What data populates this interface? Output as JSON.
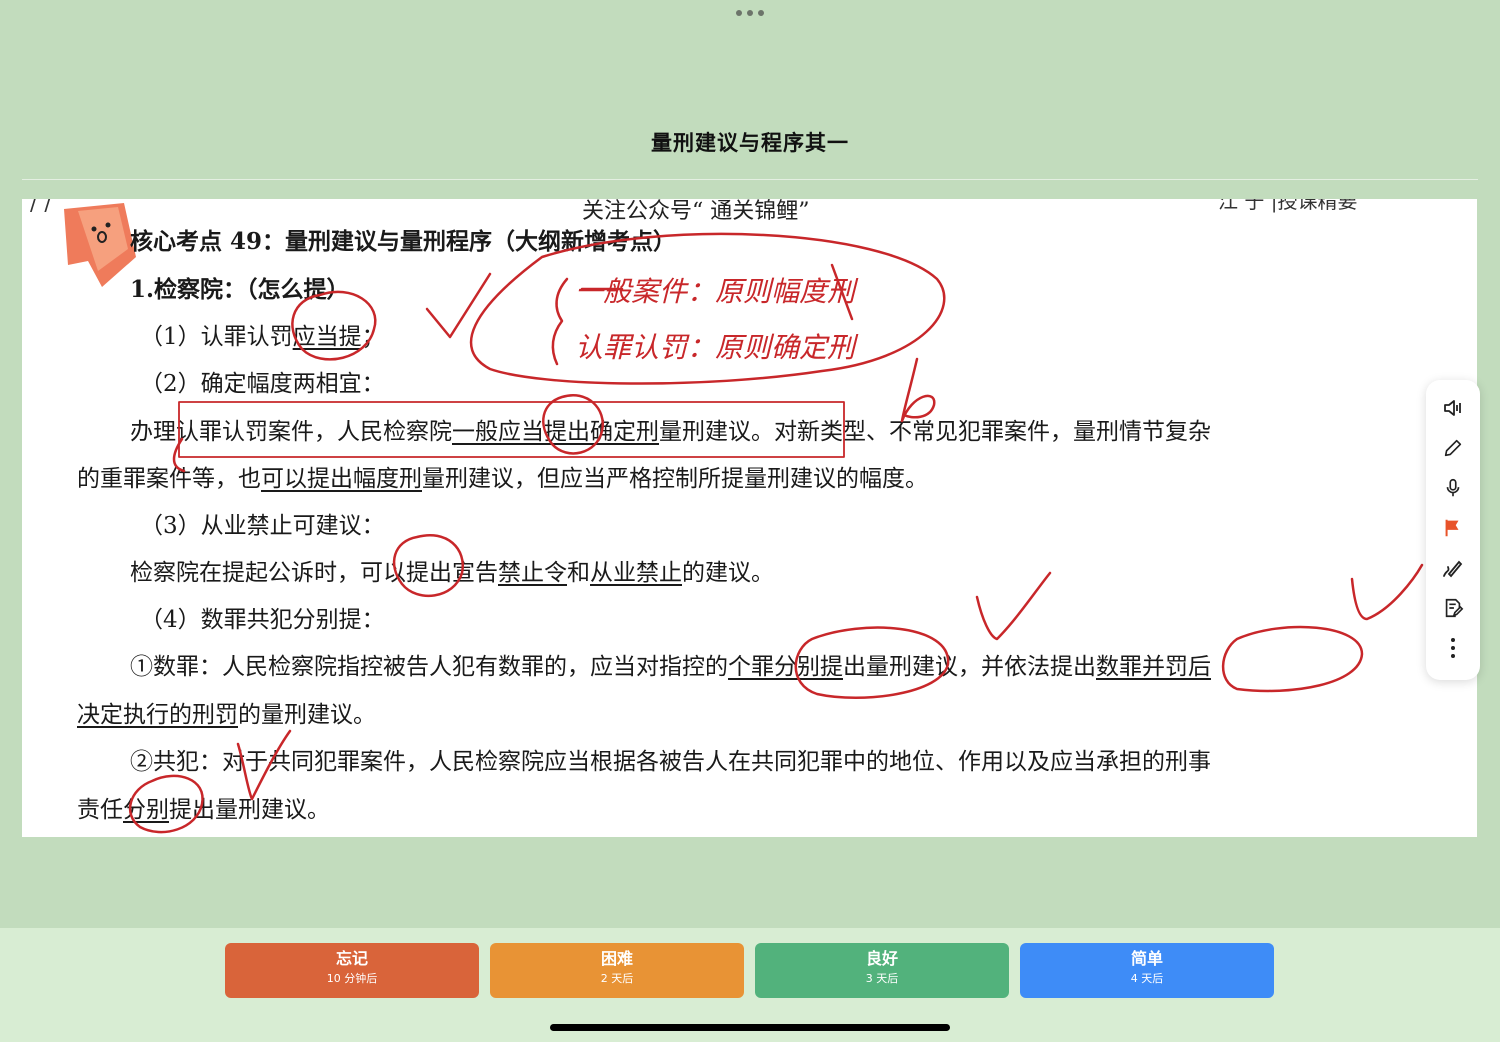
{
  "card": {
    "title": "量刑建议与程序其一"
  },
  "doc": {
    "left_mark": "/ /",
    "header": "关注公众号“ 通关锦鲤”",
    "header_right": "江 于 |授课精要",
    "heading": "核心考点 49：量刑建议与量刑程序（大纲新增考点）",
    "section1": "1.检察院：（怎么提）",
    "item1_pre": "（1）认罪认罚",
    "item1_u": "应当提",
    "item1_post": "；",
    "item2": "（2）确定幅度两相宜：",
    "p2a_1": "办理认罪认罚案件，人民检察院",
    "p2a_u": "一般应当提出确定刑",
    "p2a_2": "量刑建议。对新类型、不常见犯罪案件，量刑情节复杂",
    "p2b_1": "的重罪案件等，也",
    "p2b_u": "可以提出幅度刑",
    "p2b_2": "量刑建议，但应当严格控制所提量刑建议的幅度。",
    "item3": "（3）从业禁止可建议：",
    "p3_1": "检察院在提起公诉时，可以提出宣告",
    "p3_u1": "禁止令",
    "p3_2": "和",
    "p3_u2": "从业禁止",
    "p3_3": "的建议。",
    "item4": "（4）数罪共犯分别提：",
    "p4a_1": "①数罪：人民检察院指控被告人犯有数罪的，应当对指控的",
    "p4a_u1": "个罪分别提",
    "p4a_2": "出量刑建议，并依法提出",
    "p4a_u2": "数罪并罚后",
    "p4b_u": "决定执行的刑罚",
    "p4b_2": "的量刑建议。",
    "p5a": "②共犯：对于共同犯罪案件，人民检察院应当根据各被告人在共同犯罪中的地位、作用以及应当承担的刑事",
    "p5b_1": "责任",
    "p5b_u": "分别",
    "p5b_2": "提出量刑建议。",
    "handwriting_line1": "一般案件：原则幅度刑",
    "handwriting_line2": "认罪认罚：原则确定刑"
  },
  "toolbar": {
    "icons": [
      "speaker-icon",
      "pencil-icon",
      "microphone-icon",
      "flag-icon",
      "draw-icon",
      "note-edit-icon",
      "more-icon"
    ],
    "flag_color": "#e8532a"
  },
  "rating": {
    "again": {
      "label": "忘记",
      "sub": "10 分钟后",
      "color": "#d9643a"
    },
    "hard": {
      "label": "困难",
      "sub": "2 天后",
      "color": "#e89335"
    },
    "good": {
      "label": "良好",
      "sub": "3 天后",
      "color": "#52b27c"
    },
    "easy": {
      "label": "简单",
      "sub": "4 天后",
      "color": "#3e8cf7"
    }
  }
}
